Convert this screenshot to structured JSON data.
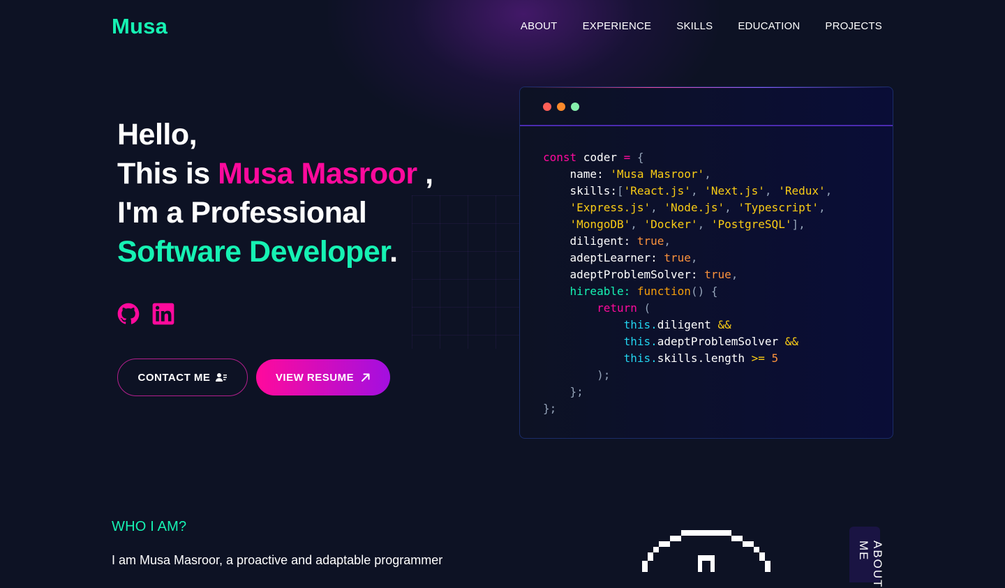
{
  "logo": "Musa",
  "nav": [
    "ABOUT",
    "EXPERIENCE",
    "SKILLS",
    "EDUCATION",
    "PROJECTS"
  ],
  "hero": {
    "hello": "Hello,",
    "this_is": "This is ",
    "name": "Musa Masroor",
    "comma": " ,",
    "im_a": "I'm a Professional",
    "role": "Software Developer",
    "period": "."
  },
  "socials": {
    "github_icon": "github-icon",
    "linkedin_icon": "linkedin-icon"
  },
  "buttons": {
    "contact": "CONTACT ME",
    "resume": "VIEW RESUME"
  },
  "code_card": {
    "dot_colors": [
      "#ff5f57",
      "#fd8a2b",
      "#86efac"
    ],
    "lines": [
      "const coder = {",
      "name: 'Musa Masroor',",
      "skills:['React.js', 'Next.js', 'Redux',",
      "'Express.js', 'Node.js', 'Typescript',",
      "'MongoDB', 'Docker', 'PostgreSQL'],",
      "diligent: true,",
      "adeptLearner: true,",
      "adeptProblemSolver: true,",
      "hireable: function() {",
      "return (",
      "this.diligent &&",
      "this.adeptProblemSolver &&",
      "this.skills.length >= 5",
      ");",
      "};",
      "};"
    ]
  },
  "who": {
    "heading": "WHO I AM?",
    "intro": "I am Musa Masroor, a proactive and adaptable programmer"
  },
  "about_tab": "ABOUT ME",
  "colors": {
    "accent_green": "#16f2b3",
    "accent_pink": "#ff0a9c",
    "accent_purple": "#a30fe0",
    "background": "#0d1224"
  }
}
